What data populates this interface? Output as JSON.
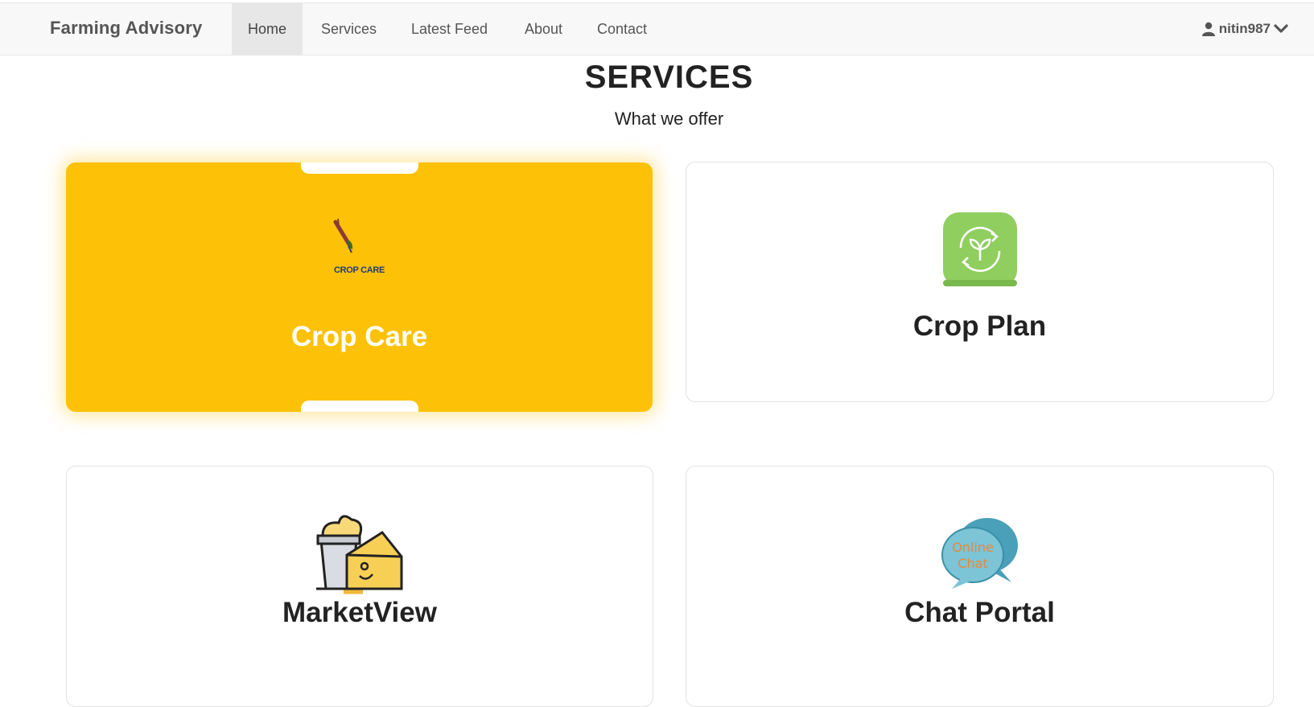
{
  "navbar": {
    "brand": "Farming Advisory",
    "items": [
      {
        "label": "Home",
        "active": true
      },
      {
        "label": "Services",
        "active": false
      },
      {
        "label": "Latest Feed",
        "active": false
      },
      {
        "label": "About",
        "active": false
      },
      {
        "label": "Contact",
        "active": false
      }
    ],
    "user": {
      "name": "nitin987",
      "icon": "user-icon",
      "dropdown_icon": "chevron-down-icon"
    }
  },
  "section": {
    "title": "SERVICES",
    "subtitle": "What we offer"
  },
  "services": [
    {
      "title": "Crop Care",
      "icon": "crop-care-logo",
      "logo_text": "CROP CARE",
      "highlighted": true
    },
    {
      "title": "Crop Plan",
      "icon": "plant-cycle-icon",
      "highlighted": false
    },
    {
      "title": "MarketView",
      "icon": "market-food-icon",
      "highlighted": false
    },
    {
      "title": "Chat Portal",
      "icon": "online-chat-icon",
      "logo_text": "Online Chat",
      "highlighted": false
    }
  ],
  "colors": {
    "accent": "#fdc107",
    "navbar_bg": "#f8f8f8",
    "active_nav_bg": "#e7e7e7",
    "crop_plan_green": "#8fce5f",
    "chat_teal": "#5aaec4",
    "chat_text": "#e8883a"
  }
}
